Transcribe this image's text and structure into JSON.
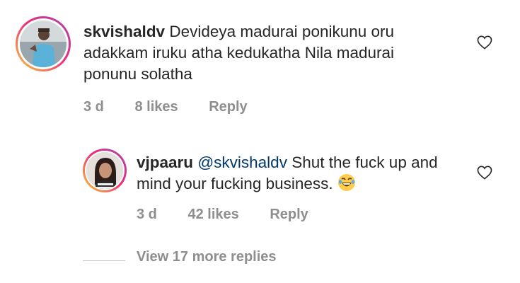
{
  "comment": {
    "username": "skvishaldv",
    "text": "Devideya madurai ponikunu oru adakkam iruku atha kedukatha  Nila madurai ponunu solatha",
    "time": "3 d",
    "likes": "8 likes",
    "reply_label": "Reply"
  },
  "reply": {
    "username": "vjpaaru",
    "mention": "@skvishaldv",
    "text": "Shut the fuck up and mind your fucking business.",
    "emoji_icon": "laughing-face-emoji-icon",
    "time": "3 d",
    "likes": "42 likes",
    "reply_label": "Reply"
  },
  "view_more_label": "View 17 more replies",
  "colors": {
    "text": "#262626",
    "meta": "#8e8e8e",
    "mention": "#00376b",
    "story_ring_start": "#f9ce34",
    "story_ring_end": "#a44ab0"
  }
}
